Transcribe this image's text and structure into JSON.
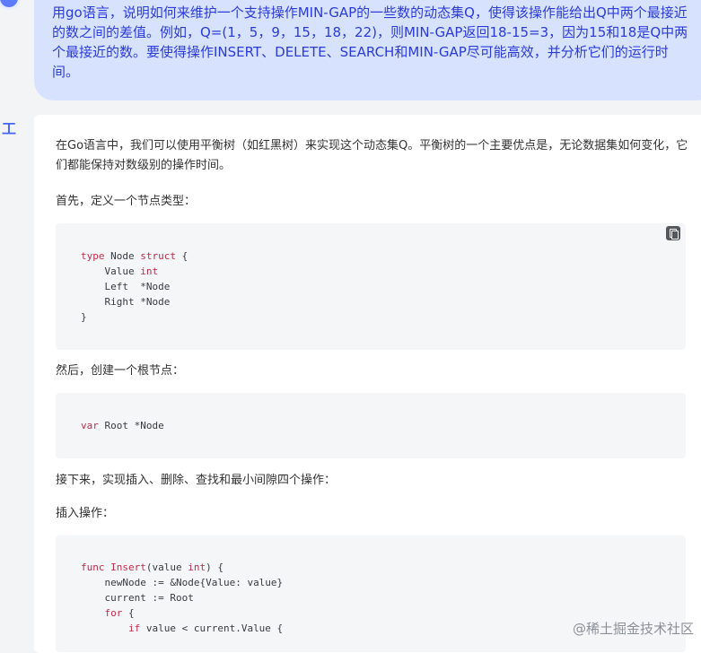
{
  "user_message": {
    "text": "用go语言，说明如何来维护一个支持操作MIN-GAP的一些数的动态集Q，使得该操作能给出Q中两个最接近的数之间的差值。例如，Q=(1，5，9，15，18，22)，则MIN-GAP返回18-15=3，因为15和18是Q中两个最接近的数。要使得操作INSERT、DELETE、SEARCH和MIN-GAP尽可能高效，并分析它们的运行时间。"
  },
  "assistant": {
    "avatar_glyph": "工",
    "intro": "在Go语言中，我们可以使用平衡树（如红黑树）来实现这个动态集Q。平衡树的一个主要优点是，无论数据集如何变化，它们都能保持对数级别的操作时间。",
    "step_define": "首先，定义一个节点类型：",
    "code_struct": {
      "kw_type": "type",
      "name": "Node",
      "kw_struct": "struct",
      "open_brace": "{",
      "f1_name": "Value",
      "f1_type": "int",
      "f2_name": "Left",
      "f2_type": "*Node",
      "f3_name": "Right",
      "f3_type": "*Node",
      "close_brace": "}"
    },
    "step_root": "然后，创建一个根节点：",
    "code_root": {
      "kw_var": "var",
      "rest": "Root *Node"
    },
    "step_ops": "接下来，实现插入、删除、查找和最小间隙四个操作：",
    "step_insert": "插入操作：",
    "code_insert": {
      "kw_func": "func",
      "func_name": "Insert",
      "param": "(value ",
      "param_type": "int",
      "after_param": ") {",
      "l2": "newNode := &Node{Value: value}",
      "l3": "current := Root",
      "kw_for": "for",
      "for_rest": " {",
      "kw_if": "if",
      "if_rest": " value < current.Value {"
    }
  },
  "watermark": {
    "text": "@稀土掘金技术社区"
  },
  "colors": {
    "user_bubble_bg": "#d7e2ff",
    "user_text": "#2b3bd8",
    "accent_avatar": "#4463ff",
    "code_keyword": "#c02b4a",
    "code_bg": "#f5f6f8"
  },
  "icons": {
    "user_avatar": "user-avatar-icon",
    "assistant_avatar": "assistant-logo-icon",
    "copy": "copy-icon"
  }
}
